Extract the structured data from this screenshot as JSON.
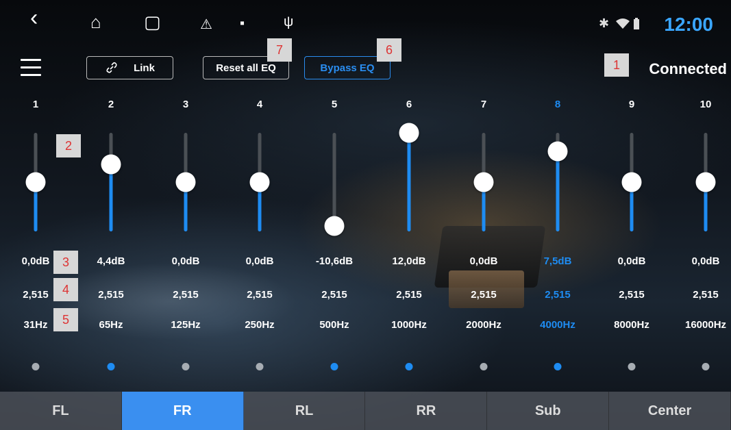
{
  "status_bar": {
    "back_icon": "‹",
    "home_icon": "⌂",
    "recent_icon": "▢",
    "warning_icon": "⚠",
    "image_icon": "▪",
    "usb_icon": "ψ",
    "clock": "12:00"
  },
  "toolbar": {
    "link_label": "Link",
    "reset_label": "Reset all EQ",
    "bypass_label": "Bypass EQ",
    "connection_status": "Connected",
    "accent_color": "#1e8cf2"
  },
  "annotations": {
    "b1": "1",
    "b2": "2",
    "b3": "3",
    "b4": "4",
    "b5": "5",
    "b6": "6",
    "b7": "7"
  },
  "bands": [
    {
      "num": "1",
      "gain": "0,0dB",
      "q": "2,515",
      "freq": "31Hz",
      "level": 0.5,
      "dot_on": false
    },
    {
      "num": "2",
      "gain": "4,4dB",
      "q": "2,515",
      "freq": "65Hz",
      "level": 0.683,
      "dot_on": true
    },
    {
      "num": "3",
      "gain": "0,0dB",
      "q": "2,515",
      "freq": "125Hz",
      "level": 0.5,
      "dot_on": false
    },
    {
      "num": "4",
      "gain": "0,0dB",
      "q": "2,515",
      "freq": "250Hz",
      "level": 0.5,
      "dot_on": false
    },
    {
      "num": "5",
      "gain": "-10,6dB",
      "q": "2,515",
      "freq": "500Hz",
      "level": 0.058,
      "dot_on": true
    },
    {
      "num": "6",
      "gain": "12,0dB",
      "q": "2,515",
      "freq": "1000Hz",
      "level": 1.0,
      "dot_on": true
    },
    {
      "num": "7",
      "gain": "0,0dB",
      "q": "2,515",
      "freq": "2000Hz",
      "level": 0.5,
      "dot_on": false
    },
    {
      "num": "8",
      "gain": "7,5dB",
      "q": "2,515",
      "freq": "4000Hz",
      "level": 0.813,
      "dot_on": true,
      "active": true
    },
    {
      "num": "9",
      "gain": "0,0dB",
      "q": "2,515",
      "freq": "8000Hz",
      "level": 0.5,
      "dot_on": false
    },
    {
      "num": "10",
      "gain": "0,0dB",
      "q": "2,515",
      "freq": "16000Hz",
      "level": 0.5,
      "dot_on": false
    }
  ],
  "tabs": [
    {
      "label": "FL",
      "selected": false
    },
    {
      "label": "FR",
      "selected": true
    },
    {
      "label": "RL",
      "selected": false
    },
    {
      "label": "RR",
      "selected": false
    },
    {
      "label": "Sub",
      "selected": false
    },
    {
      "label": "Center",
      "selected": false
    }
  ]
}
